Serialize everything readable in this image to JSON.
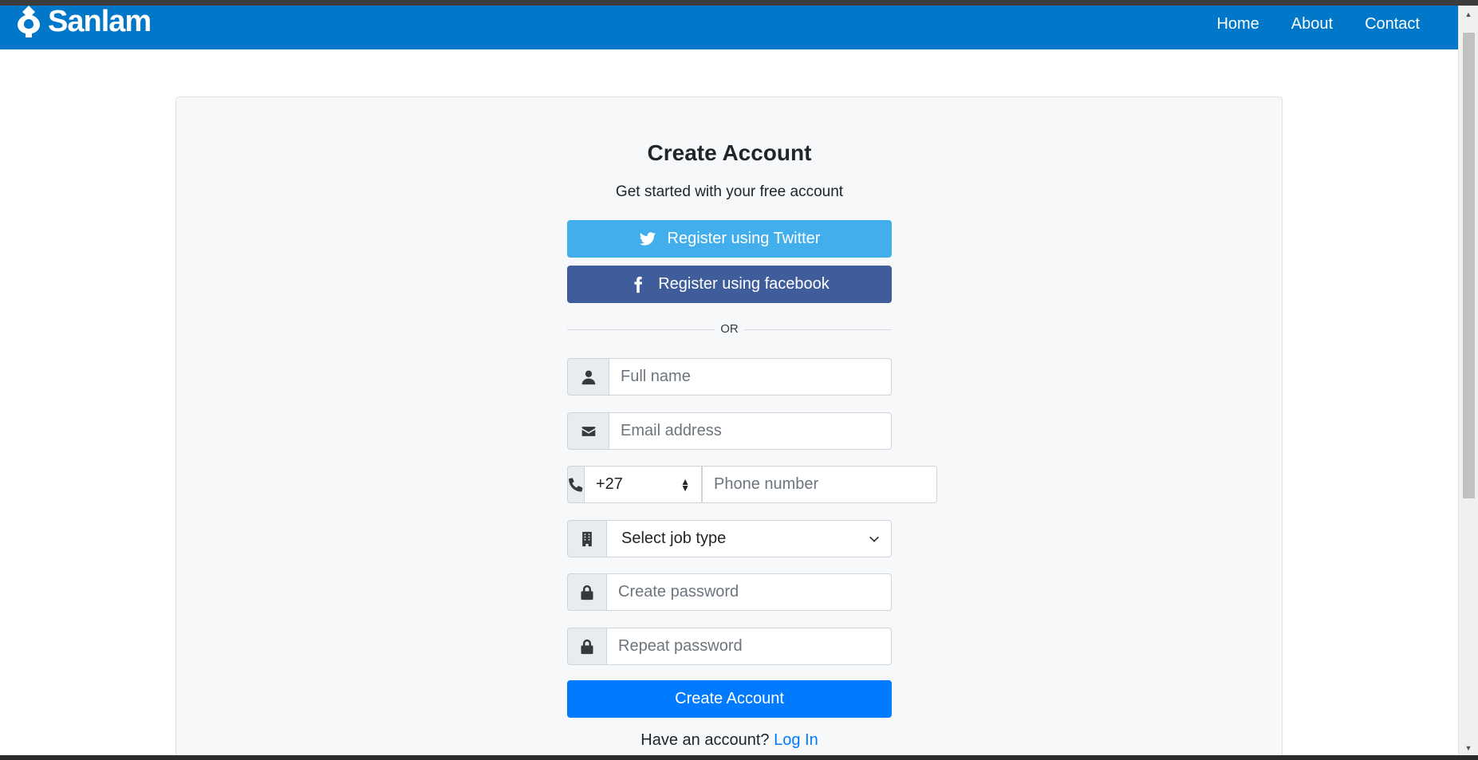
{
  "navbar": {
    "brand": "Sanlam",
    "links": [
      "Home",
      "About",
      "Contact"
    ]
  },
  "form": {
    "title": "Create Account",
    "subtitle": "Get started with your free account",
    "twitter_button": "Register using Twitter",
    "facebook_button": "Register using facebook",
    "divider": "OR",
    "full_name_placeholder": "Full name",
    "email_placeholder": "Email address",
    "country_code": "+27",
    "phone_placeholder": "Phone number",
    "job_type_selected": "Select job type",
    "password_placeholder": "Create password",
    "repeat_password_placeholder": "Repeat password",
    "submit_button": "Create Account",
    "login_prompt": "Have an account?",
    "login_link": "Log In"
  },
  "icons": {
    "brand": "sanlam-logo-icon",
    "twitter": "twitter-icon",
    "facebook": "facebook-icon",
    "name": "user-icon",
    "email": "envelope-icon",
    "phone": "phone-icon",
    "job": "building-icon",
    "password": "lock-icon",
    "repeat": "lock-icon"
  },
  "colors": {
    "navbar": "#0077c8",
    "twitter": "#42aeec",
    "facebook": "#405d9b",
    "primary": "#007bff"
  }
}
